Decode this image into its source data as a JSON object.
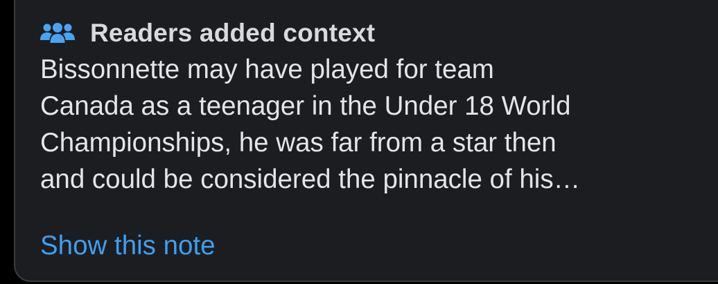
{
  "note": {
    "header_icon": "people-group-icon",
    "header_title": "Readers added context",
    "body_text": "Bissonnette may have played for team\nCanada as a teenager in the Under 18 World\nChampionships, he was far from a star then\nand could be considered the pinnacle of his…",
    "show_link_label": "Show this note"
  },
  "colors": {
    "page_background": "#000000",
    "card_background": "#1c1d21",
    "card_border": "#3a3c40",
    "title_text": "#d9dadb",
    "body_text": "#e4e5e6",
    "link": "#3e9ff0",
    "icon": "#4aa3f0"
  }
}
